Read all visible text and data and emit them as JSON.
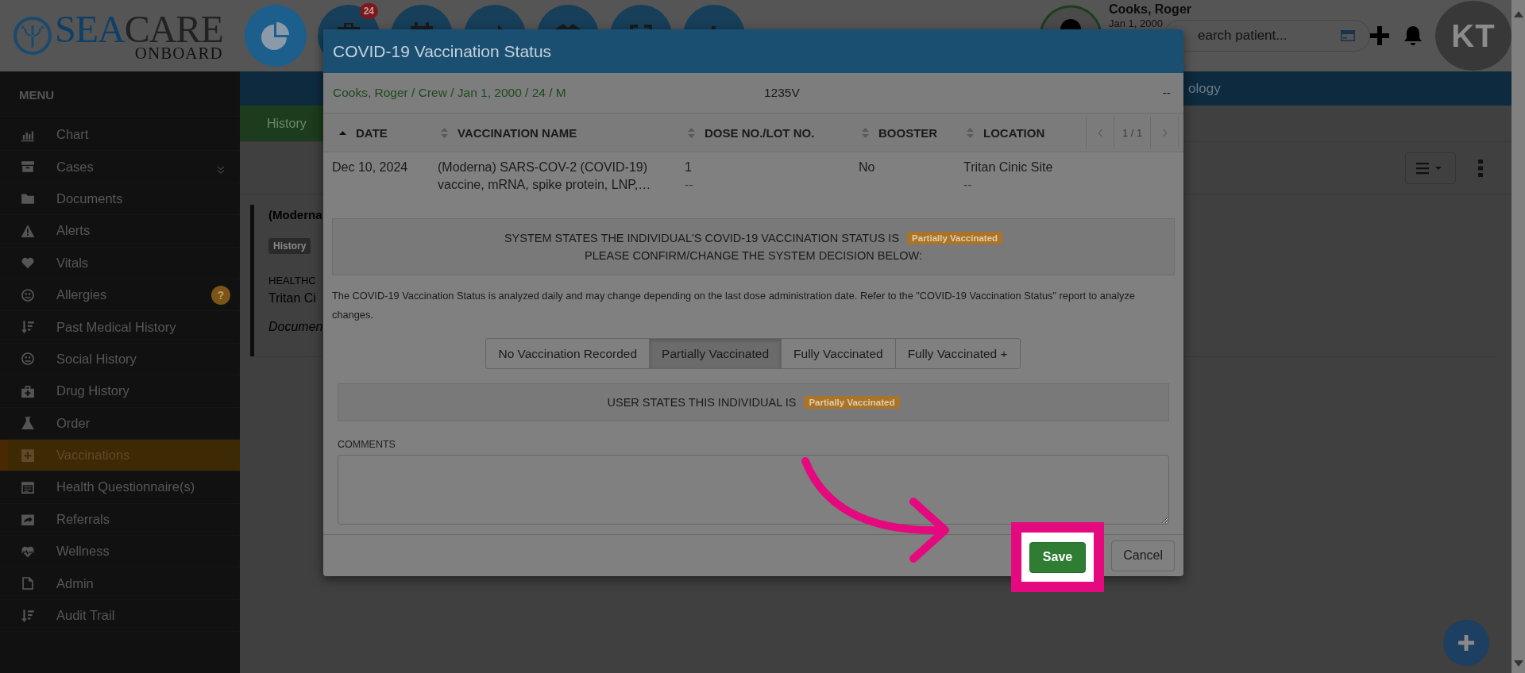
{
  "header": {
    "logo": {
      "brand_primary": "SEA",
      "brand_secondary": "CARE",
      "tagline": "ONBOARD"
    },
    "nav_buttons": [
      {
        "selected": true
      },
      {
        "selected": false,
        "badge": "24"
      },
      {
        "selected": false
      },
      {
        "selected": false
      },
      {
        "selected": false
      },
      {
        "selected": false
      },
      {
        "selected": false
      }
    ],
    "patient": {
      "name": "Cooks, Roger",
      "dob": "Jan 1, 2000"
    },
    "search": {
      "placeholder": "earch patient..."
    },
    "user_initials": "KT"
  },
  "top_nav": {
    "label": "ology"
  },
  "sidebar": {
    "title": "MENU",
    "items": [
      {
        "label": "Chart",
        "selected": false,
        "expandable": false
      },
      {
        "label": "Cases",
        "selected": false,
        "expandable": true
      },
      {
        "label": "Documents",
        "selected": false,
        "expandable": false
      },
      {
        "label": "Alerts",
        "selected": false,
        "expandable": false
      },
      {
        "label": "Vitals",
        "selected": false,
        "expandable": false
      },
      {
        "label": "Allergies",
        "selected": false,
        "expandable": false,
        "badge": "?"
      },
      {
        "label": "Past Medical History",
        "selected": false,
        "expandable": false
      },
      {
        "label": "Social History",
        "selected": false,
        "expandable": false
      },
      {
        "label": "Drug History",
        "selected": false,
        "expandable": false
      },
      {
        "label": "Order",
        "selected": false,
        "expandable": false
      },
      {
        "label": "Vaccinations",
        "selected": true,
        "expandable": false
      },
      {
        "label": "Health Questionnaire(s)",
        "selected": false,
        "expandable": false
      },
      {
        "label": "Referrals",
        "selected": false,
        "expandable": false
      },
      {
        "label": "Wellness",
        "selected": false,
        "expandable": false
      },
      {
        "label": "Admin",
        "selected": false,
        "expandable": false
      },
      {
        "label": "Audit Trail",
        "selected": false,
        "expandable": false
      }
    ]
  },
  "content": {
    "tab": "History",
    "card": {
      "title": "(Moderna",
      "tag": "History",
      "field_label": "HEALTHC",
      "field_value": "Tritan Ci",
      "note": "Documen"
    }
  },
  "modal": {
    "title": "COVID-19 Vaccination Status",
    "patient_line": "Cooks, Roger / Crew / Jan 1, 2000 / 24 / M",
    "code": "1235V",
    "extra": "--",
    "columns": [
      {
        "label": "DATE",
        "sorted": true
      },
      {
        "label": "VACCINATION NAME",
        "sorted": false
      },
      {
        "label": "DOSE NO./LOT NO.",
        "sorted": false
      },
      {
        "label": "BOOSTER",
        "sorted": false
      },
      {
        "label": "LOCATION",
        "sorted": false
      }
    ],
    "pager": "1 / 1",
    "rows": [
      {
        "date": "Dec 10, 2024",
        "name_lines": [
          "(Moderna) SARS-COV-2 (COVID-19)",
          "vaccine, mRNA, spike protein, LNP,…"
        ],
        "dose": "1",
        "lot": "--",
        "booster": "No",
        "location": "Tritan Cinic Site",
        "location_detail": "--"
      }
    ],
    "system_status": {
      "text": "SYSTEM STATES THE INDIVIDUAL'S COVID-19 VACCINATION STATUS IS",
      "status": "Partially Vaccinated",
      "prompt": "PLEASE CONFIRM/CHANGE THE SYSTEM DECISION BELOW:"
    },
    "info": "The COVID-19 Vaccination Status is analyzed daily and may change depending on the last dose administration date. Refer to the \"COVID-19 Vaccination Status\" report to analyze changes.",
    "options": [
      {
        "label": "No Vaccination Recorded",
        "selected": false
      },
      {
        "label": "Partially Vaccinated",
        "selected": true
      },
      {
        "label": "Fully Vaccinated",
        "selected": false
      },
      {
        "label": "Fully Vaccinated +",
        "selected": false
      }
    ],
    "user_status": {
      "text": "USER STATES THIS INDIVIDUAL IS",
      "status": "Partially Vaccinated"
    },
    "comments_label": "COMMENTS",
    "buttons": [
      {
        "label": "Save",
        "kind": "primary",
        "highlighted": true
      },
      {
        "label": "Cancel",
        "kind": "default",
        "highlighted": false
      }
    ]
  }
}
